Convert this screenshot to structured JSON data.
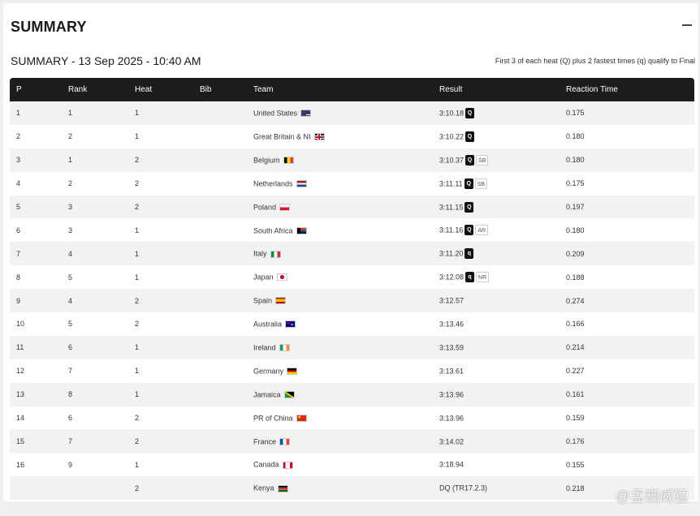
{
  "header": {
    "title": "SUMMARY",
    "subtitle": "SUMMARY - 13 Sep 2025 - 10:40 AM",
    "qualification_note": "First 3 of each heat (Q) plus 2 fastest times (q) qualify to Final"
  },
  "table": {
    "columns": [
      "P",
      "Rank",
      "Heat",
      "Bib",
      "Team",
      "Result",
      "Reaction Time"
    ],
    "rows": [
      {
        "p": "1",
        "rank": "1",
        "heat": "1",
        "bib": "",
        "team": "United States",
        "flag": "us",
        "result": "3:10.18",
        "q": "Q",
        "record": "",
        "reaction": "0.175"
      },
      {
        "p": "2",
        "rank": "2",
        "heat": "1",
        "bib": "",
        "team": "Great Britain & NI",
        "flag": "gb",
        "result": "3:10.22",
        "q": "Q",
        "record": "",
        "reaction": "0.180"
      },
      {
        "p": "3",
        "rank": "1",
        "heat": "2",
        "bib": "",
        "team": "Belgium",
        "flag": "be",
        "result": "3:10.37",
        "q": "Q",
        "record": "SB",
        "reaction": "0.180"
      },
      {
        "p": "4",
        "rank": "2",
        "heat": "2",
        "bib": "",
        "team": "Netherlands",
        "flag": "nl",
        "result": "3:11.11",
        "q": "Q",
        "record": "SB",
        "reaction": "0.175"
      },
      {
        "p": "5",
        "rank": "3",
        "heat": "2",
        "bib": "",
        "team": "Poland",
        "flag": "pl",
        "result": "3:11.15",
        "q": "Q",
        "record": "",
        "reaction": "0.197"
      },
      {
        "p": "6",
        "rank": "3",
        "heat": "1",
        "bib": "",
        "team": "South Africa",
        "flag": "za",
        "result": "3:11.16",
        "q": "Q",
        "record": "AR",
        "reaction": "0.180"
      },
      {
        "p": "7",
        "rank": "4",
        "heat": "1",
        "bib": "",
        "team": "Italy",
        "flag": "it",
        "result": "3:11.20",
        "q": "q",
        "record": "",
        "reaction": "0.209"
      },
      {
        "p": "8",
        "rank": "5",
        "heat": "1",
        "bib": "",
        "team": "Japan",
        "flag": "jp",
        "result": "3:12.08",
        "q": "q",
        "record": "NR",
        "reaction": "0.188"
      },
      {
        "p": "9",
        "rank": "4",
        "heat": "2",
        "bib": "",
        "team": "Spain",
        "flag": "es",
        "result": "3:12.57",
        "q": "",
        "record": "",
        "reaction": "0.274"
      },
      {
        "p": "10",
        "rank": "5",
        "heat": "2",
        "bib": "",
        "team": "Australia",
        "flag": "au",
        "result": "3:13.46",
        "q": "",
        "record": "",
        "reaction": "0.166"
      },
      {
        "p": "11",
        "rank": "6",
        "heat": "1",
        "bib": "",
        "team": "Ireland",
        "flag": "ie",
        "result": "3:13.59",
        "q": "",
        "record": "",
        "reaction": "0.214"
      },
      {
        "p": "12",
        "rank": "7",
        "heat": "1",
        "bib": "",
        "team": "Germany",
        "flag": "de",
        "result": "3:13.61",
        "q": "",
        "record": "",
        "reaction": "0.227"
      },
      {
        "p": "13",
        "rank": "8",
        "heat": "1",
        "bib": "",
        "team": "Jamaica",
        "flag": "jm",
        "result": "3:13.96",
        "q": "",
        "record": "",
        "reaction": "0.161"
      },
      {
        "p": "14",
        "rank": "6",
        "heat": "2",
        "bib": "",
        "team": "PR of China",
        "flag": "cn",
        "result": "3:13.96",
        "q": "",
        "record": "",
        "reaction": "0.159"
      },
      {
        "p": "15",
        "rank": "7",
        "heat": "2",
        "bib": "",
        "team": "France",
        "flag": "fr",
        "result": "3:14.02",
        "q": "",
        "record": "",
        "reaction": "0.176"
      },
      {
        "p": "16",
        "rank": "9",
        "heat": "1",
        "bib": "",
        "team": "Canada",
        "flag": "ca",
        "result": "3:18.94",
        "q": "",
        "record": "",
        "reaction": "0.155"
      },
      {
        "p": "",
        "rank": "",
        "heat": "2",
        "bib": "",
        "team": "Kenya",
        "flag": "ke",
        "result": "DQ (TR17.2.3)",
        "q": "",
        "record": "",
        "reaction": "0.218"
      }
    ]
  },
  "watermark": "@孟巍威猛"
}
